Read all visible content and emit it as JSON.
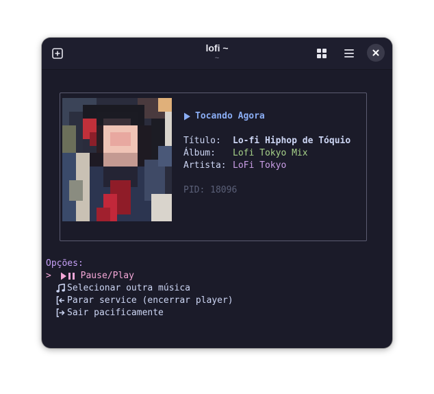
{
  "window": {
    "title": "lofi ~",
    "subtitle": "~"
  },
  "titlebar": {
    "new_tab_icon": "plus-square-icon",
    "grid_icon": "grid-icon",
    "menu_icon": "hamburger-menu-icon",
    "close_icon": "close-icon"
  },
  "player": {
    "now_playing_label": "Tocando Agora",
    "title_key": "Título:",
    "title_value": "Lo-fi Hiphop de Tóquio",
    "album_key": "Álbum:",
    "album_value": "Lofi Tokyo Mix",
    "artist_key": "Artista:",
    "artist_value": "LoFi Tokyo",
    "pid_text": "PID: 18096"
  },
  "menu": {
    "header": "Opções:",
    "cursor": ">",
    "items": [
      {
        "label": "Pause/Play",
        "icon": "play-pause-icon",
        "selected": true
      },
      {
        "label": "Selecionar outra música",
        "icon": "music-note-icon",
        "selected": false
      },
      {
        "label": "Parar service (encerrar player)",
        "icon": "stop-service-icon",
        "selected": false
      },
      {
        "label": "Sair pacificamente",
        "icon": "exit-icon",
        "selected": false
      }
    ]
  },
  "colors": {
    "background": "#1b1b29",
    "accent_blue": "#8aadf4",
    "accent_pink": "#f5a8d8",
    "accent_purple": "#c6a0f6",
    "album_green": "#a6d189",
    "artist_mauve": "#ca9ee6"
  }
}
